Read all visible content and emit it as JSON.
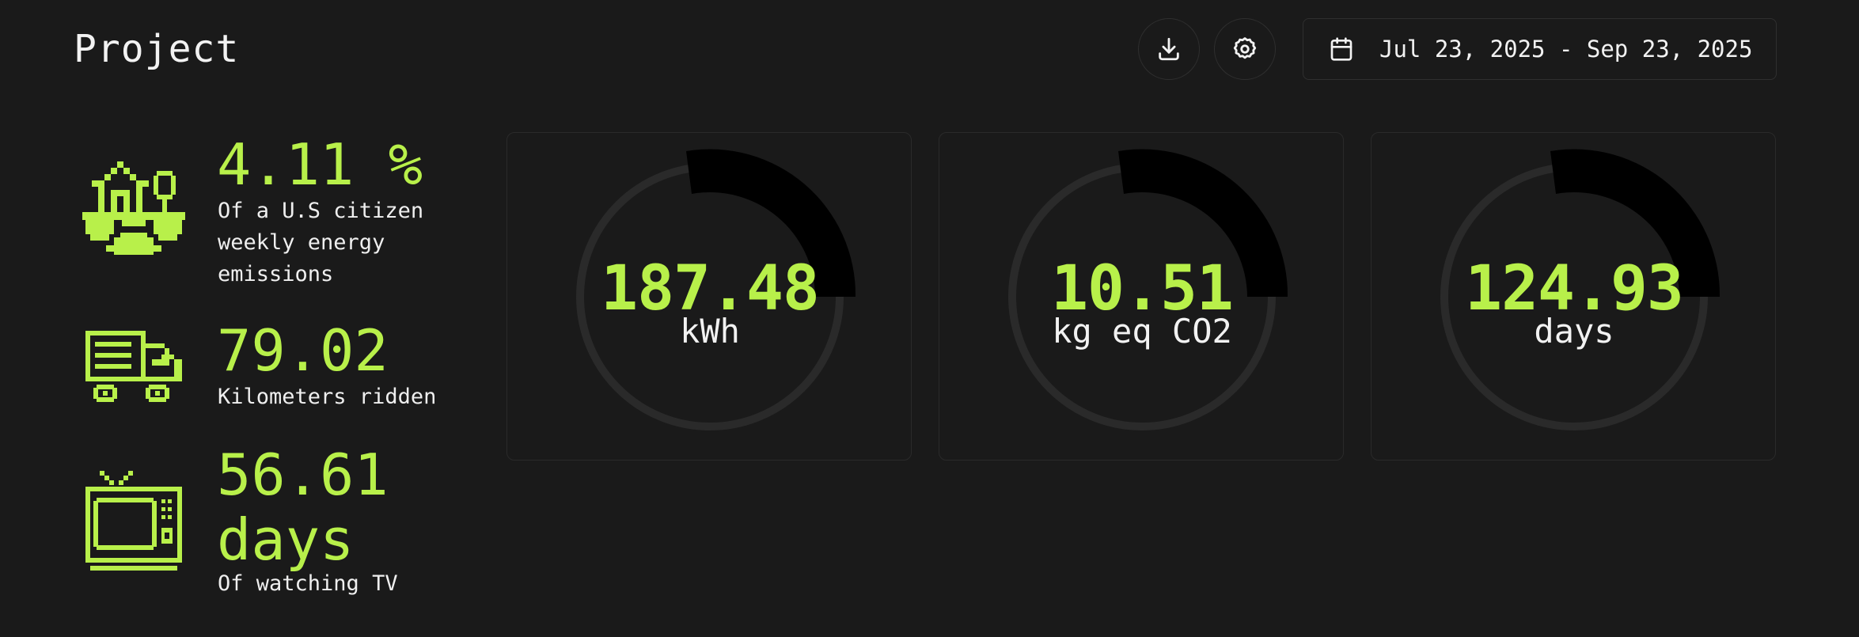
{
  "header": {
    "title": "Project",
    "date_range": "Jul 23, 2025 - Sep 23, 2025"
  },
  "icons": {
    "download": "download-icon",
    "settings": "gear-icon",
    "calendar": "calendar-icon"
  },
  "stats": [
    {
      "icon": "house-icon",
      "value": "4.11 %",
      "description_lines": [
        "Of a U.S citizen",
        "weekly energy",
        "emissions"
      ]
    },
    {
      "icon": "truck-icon",
      "value": "79.02",
      "description_lines": [
        "Kilometers ridden"
      ]
    },
    {
      "icon": "tv-icon",
      "value_lines": [
        "56.61",
        "days"
      ],
      "description_lines": [
        "Of watching TV"
      ]
    }
  ],
  "cards": [
    {
      "value": "187.48",
      "unit": "kWh"
    },
    {
      "value": "10.51",
      "unit": "kg eq CO2"
    },
    {
      "value": "124.93",
      "unit": "days"
    }
  ],
  "colors": {
    "background": "#1a1a1a",
    "accent": "#b8f04a",
    "text": "#f2f2f2",
    "ring_track": "#2a2a2a",
    "ring_arc": "#000000"
  }
}
